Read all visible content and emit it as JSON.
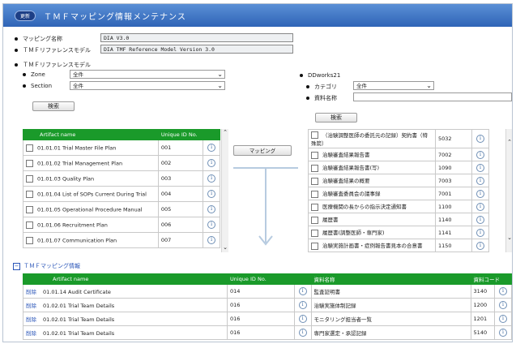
{
  "header": {
    "badge": "更新",
    "title": "ＴＭＦマッピング情報メンテナンス"
  },
  "mapping": {
    "name_label": "マッピング名称",
    "name_value": "DIA V3.0",
    "ref_label": "ＴＭＦリファレンスモデル",
    "ref_value": "DIA TMF Reference Model Version 3.0"
  },
  "left_filter": {
    "title": "ＴＭＦリファレンスモデル",
    "zone_label": "Zone",
    "zone_value": "全件",
    "section_label": "Section",
    "section_value": "全件",
    "search_label": "検索"
  },
  "right_filter": {
    "title": "DDworks21",
    "category_label": "カテゴリ",
    "category_value": "全件",
    "docname_label": "資料名称",
    "docname_value": "",
    "search_label": "検索"
  },
  "left_table": {
    "headers": [
      "Artifact name",
      "Unique ID No."
    ],
    "rows": [
      {
        "name": "01.01.01 Trial Master File Plan",
        "id": "001"
      },
      {
        "name": "01.01.02 Trial Management Plan",
        "id": "002"
      },
      {
        "name": "01.01.03 Quality Plan",
        "id": "003"
      },
      {
        "name": "01.01.04 List of SOPs Current During Trial",
        "id": "004"
      },
      {
        "name": "01.01.05 Operational Procedure Manual",
        "id": "005"
      },
      {
        "name": "01.01.06 Recruitment Plan",
        "id": "006"
      },
      {
        "name": "01.01.07 Communication Plan",
        "id": "007"
      }
    ]
  },
  "mapping_button": "マッピング",
  "right_table": {
    "rows": [
      {
        "name": "（治験調整医師の委託元の記録）契約書（特殊箭）",
        "code": "5032"
      },
      {
        "name": "治験審査結果報告書",
        "code": "7002"
      },
      {
        "name": "治験審査結果報告書(写)",
        "code": "1090"
      },
      {
        "name": "治験審査結果の概要",
        "code": "7003"
      },
      {
        "name": "治験審査委員会の議事録",
        "code": "7001"
      },
      {
        "name": "医療機関の長からの指示決定通知書",
        "code": "1100"
      },
      {
        "name": "履歴書",
        "code": "1140"
      },
      {
        "name": "履歴書(調整医師・専門家)",
        "code": "1141"
      },
      {
        "name": "治験実施計画書・症例報告書見本の合意書",
        "code": "1150"
      }
    ]
  },
  "tmf_mapping": {
    "title": "ＴＭＦマッピング情報",
    "toggle": "−",
    "headers": [
      "Artifact name",
      "Unique ID No.",
      "資料名称",
      "資料コード"
    ],
    "delete_label": "削除",
    "rows": [
      {
        "name": "01.01.14 Audit Certificate",
        "id": "014",
        "doc": "監査証明書",
        "code": "3140"
      },
      {
        "name": "01.02.01 Trial Team Details",
        "id": "016",
        "doc": "治験実施体制記録",
        "code": "1200"
      },
      {
        "name": "01.02.01 Trial Team Details",
        "id": "016",
        "doc": "モニタリング担当者一覧",
        "code": "1201"
      },
      {
        "name": "01.02.01 Trial Team Details",
        "id": "016",
        "doc": "専門家選定・承認記録",
        "code": "5140"
      }
    ]
  },
  "icons": {
    "info": "info-icon",
    "checkbox": "checkbox-icon",
    "chevron": "chevron-down-icon",
    "arrow": "arrow-down-icon"
  },
  "colors": {
    "header_blue": "#2f64b6",
    "table_green": "#1a9a2a",
    "link_blue": "#2a55b8"
  }
}
